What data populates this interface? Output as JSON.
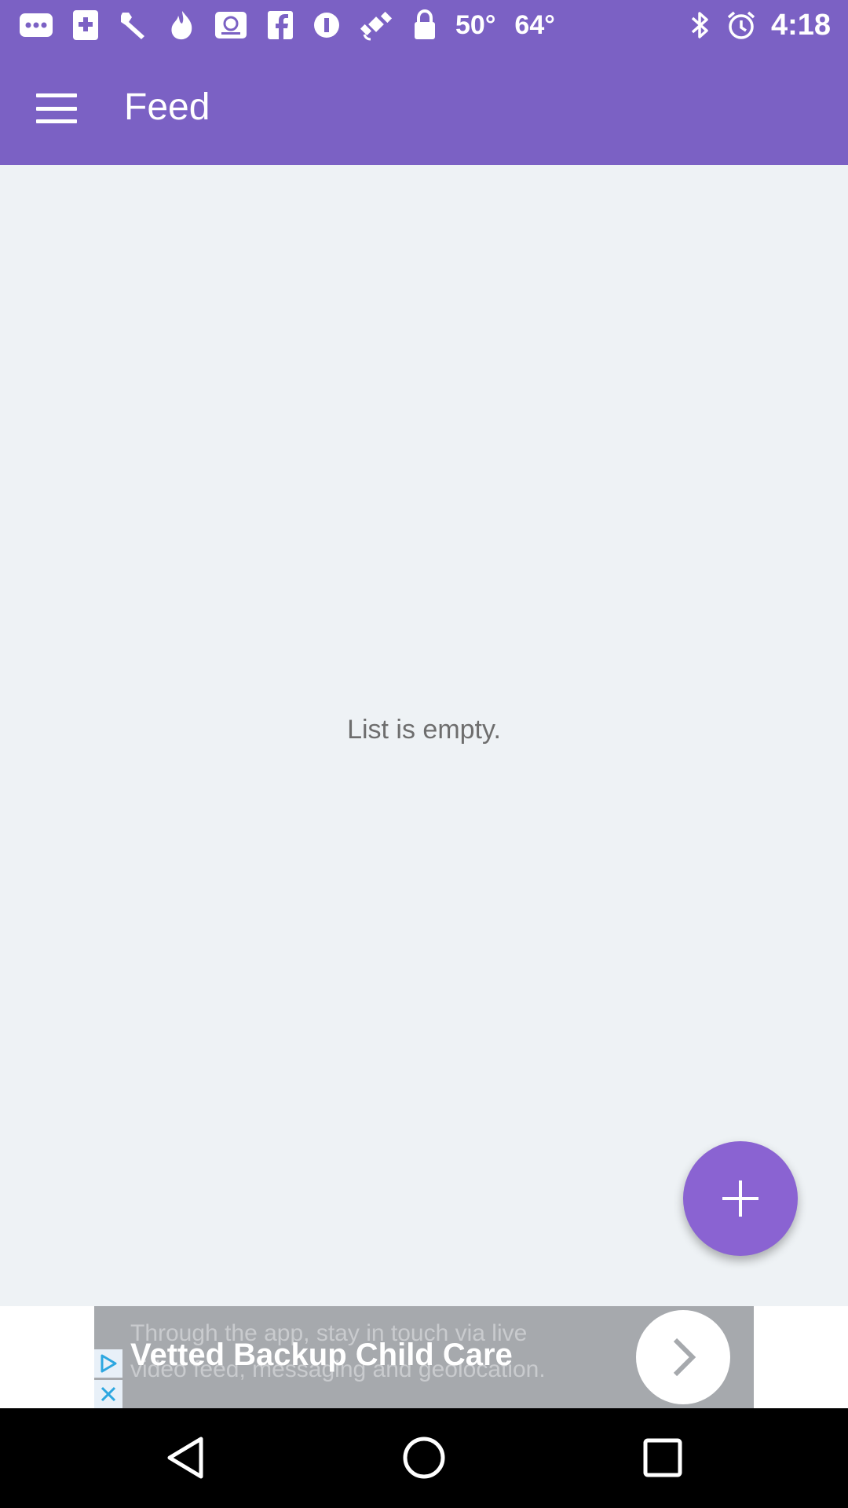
{
  "status_bar": {
    "left_icons": [
      "more-icon",
      "medical-icon",
      "wrench-icon",
      "flame-icon",
      "image-icon",
      "facebook-icon",
      "info-icon",
      "satellite-icon",
      "lock-icon"
    ],
    "temp1": "50°",
    "temp2": "64°",
    "right_icons": [
      "bluetooth-icon",
      "alarm-icon"
    ],
    "time": "4:18"
  },
  "app_bar": {
    "title": "Feed",
    "menu_icon": "hamburger-menu-icon"
  },
  "main": {
    "empty_message": "List is empty."
  },
  "fab": {
    "icon": "plus-icon",
    "color": "#8a63d2"
  },
  "ad": {
    "title": "Vetted Backup Child Care",
    "subtitle_line1": "Through the app, stay in touch via live",
    "subtitle_line2": "video feed, messaging and geolocation.",
    "arrow_icon": "chevron-right-icon",
    "adchoices_icon": "play-triangle-icon",
    "close_icon": "close-icon"
  },
  "nav_bar": {
    "back_icon": "back-triangle-icon",
    "home_icon": "home-circle-icon",
    "recents_icon": "recents-square-icon"
  },
  "colors": {
    "primary": "#7b61c4",
    "background": "#eef2f5",
    "accent": "#8a63d2"
  }
}
